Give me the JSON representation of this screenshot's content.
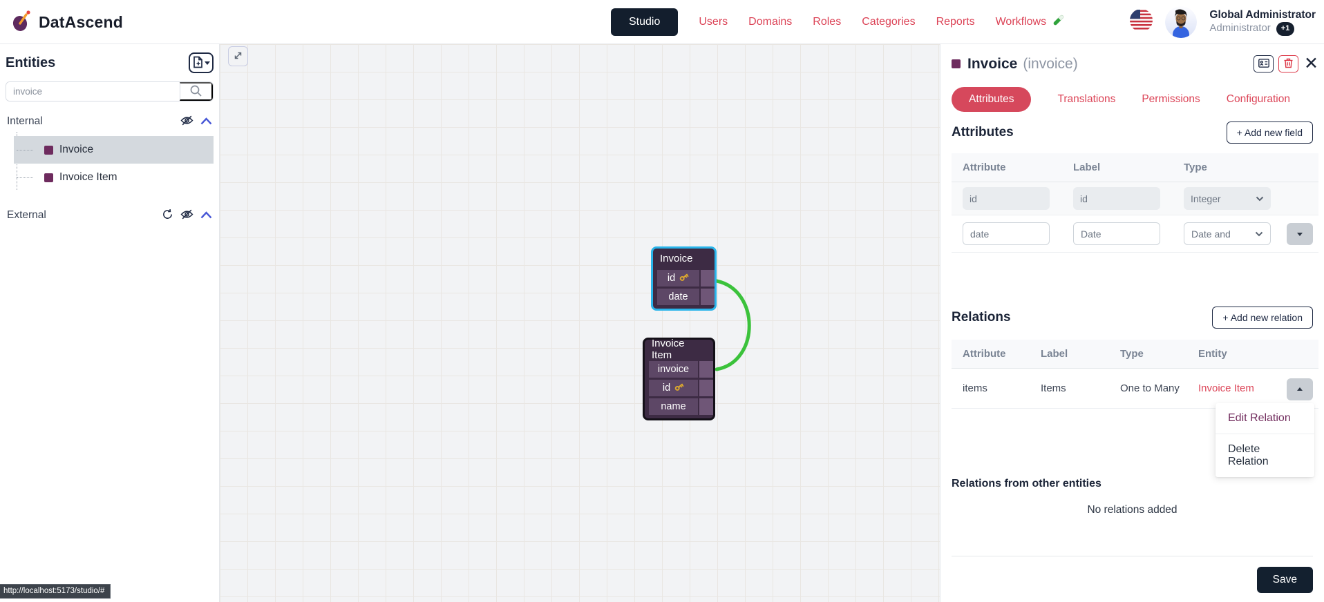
{
  "brand": {
    "name": "DatAscend"
  },
  "nav": {
    "active": "Studio",
    "links": [
      "Users",
      "Domains",
      "Roles",
      "Categories",
      "Reports",
      "Workflows"
    ],
    "workflows_icon": "test-tube-icon",
    "language_icon": "us-flag-icon"
  },
  "user": {
    "name": "Global Administrator",
    "role": "Administrator",
    "badge": "+1"
  },
  "sidebar": {
    "title": "Entities",
    "search": {
      "value": "invoice",
      "placeholder": ""
    },
    "sections": [
      {
        "label": "Internal",
        "icons": [
          "eye-off-icon",
          "chevron-up-icon"
        ],
        "items": [
          {
            "label": "Invoice",
            "selected": true
          },
          {
            "label": "Invoice Item",
            "selected": false
          }
        ]
      },
      {
        "label": "External",
        "icons": [
          "refresh-icon",
          "eye-off-icon",
          "chevron-up-icon"
        ],
        "items": []
      }
    ]
  },
  "canvas": {
    "nodes": [
      {
        "title": "Invoice",
        "selected": true,
        "fields": [
          {
            "name": "id",
            "key": true
          },
          {
            "name": "date",
            "key": false
          }
        ]
      },
      {
        "title": "Invoice Item",
        "selected": false,
        "fields": [
          {
            "name": "invoice",
            "key": false
          },
          {
            "name": "id",
            "key": true
          },
          {
            "name": "name",
            "key": false
          }
        ]
      }
    ],
    "edge": {
      "from": "Invoice.id",
      "to": "Invoice Item.invoice",
      "color": "#3bc23b"
    }
  },
  "panel": {
    "title": "Invoice",
    "subtitle": "(invoice)",
    "header_icons": [
      "id-card-icon",
      "trash-icon",
      "close-icon"
    ],
    "close_glyph": "✕",
    "tabs": {
      "active": "Attributes",
      "others": [
        "Translations",
        "Permissions",
        "Configuration"
      ]
    },
    "attributes": {
      "heading": "Attributes",
      "add_button": "+ Add new field",
      "columns": [
        "Attribute",
        "Label",
        "Type"
      ],
      "rows": [
        {
          "attribute": "id",
          "label": "id",
          "type": "Integer",
          "disabled": true
        },
        {
          "attribute": "date",
          "label": "Date",
          "type": "Date and",
          "disabled": false
        }
      ]
    },
    "relations": {
      "heading": "Relations",
      "add_button": "+ Add new relation",
      "columns": [
        "Attribute",
        "Label",
        "Type",
        "Entity"
      ],
      "rows": [
        {
          "attribute": "items",
          "label": "Items",
          "type": "One to Many",
          "entity": "Invoice Item"
        }
      ]
    },
    "relation_menu": {
      "edit": "Edit Relation",
      "delete": "Delete Relation"
    },
    "other_relations": {
      "heading": "Relations from other entities",
      "empty": "No relations added"
    },
    "save_button": "Save"
  },
  "statusbar": {
    "url": "http://localhost:5173/studio/#"
  },
  "colors": {
    "accent_red": "#dc4457",
    "tab_pill": "#d6485c",
    "navy": "#13202f",
    "entity_purple": "#6e2b5e",
    "node_bg": "#3d2b44",
    "node_row": "#5d4766",
    "node_selected_border": "#29b4ea",
    "edge_green": "#3bc23b",
    "canvas_bg": "#f2f3f5"
  }
}
